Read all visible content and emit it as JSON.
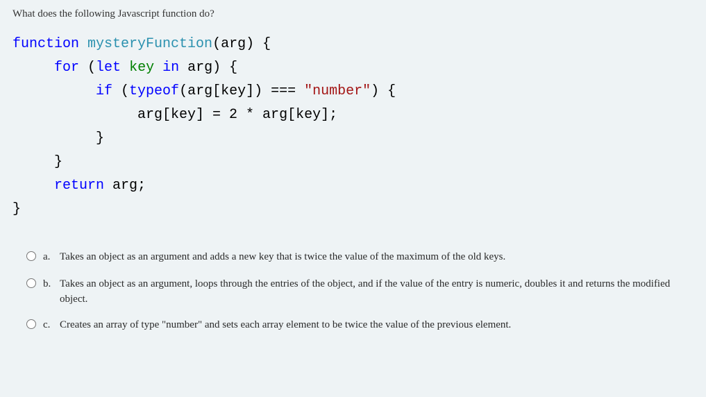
{
  "question": "What does the following Javascript function do?",
  "code": {
    "l1_a": "function ",
    "l1_b": "mysteryFunction",
    "l1_c": "(arg) {",
    "l2_a": "     for ",
    "l2_b": "(",
    "l2_c": "let ",
    "l2_d": "key ",
    "l2_e": "in ",
    "l2_f": "arg) {",
    "l3_a": "          if ",
    "l3_b": "(",
    "l3_c": "typeof",
    "l3_d": "(arg[key]) === ",
    "l3_e": "\"number\"",
    "l3_f": ") {",
    "l4_a": "               arg[key] = 2 * arg[key];",
    "l5_a": "          }",
    "l6_a": "     }",
    "l7_a": "     return ",
    "l7_b": "arg;",
    "l8_a": "}"
  },
  "options": [
    {
      "letter": "a.",
      "text": "Takes an object as an argument and adds a new key that is twice the value of the maximum of the old keys."
    },
    {
      "letter": "b.",
      "text": "Takes an object as an argument, loops through the entries of the object, and if the value of the entry is numeric, doubles it and returns the modified object."
    },
    {
      "letter": "c.",
      "text": "Creates an array of type \"number\" and sets each array element to be twice the value of the previous element."
    }
  ]
}
